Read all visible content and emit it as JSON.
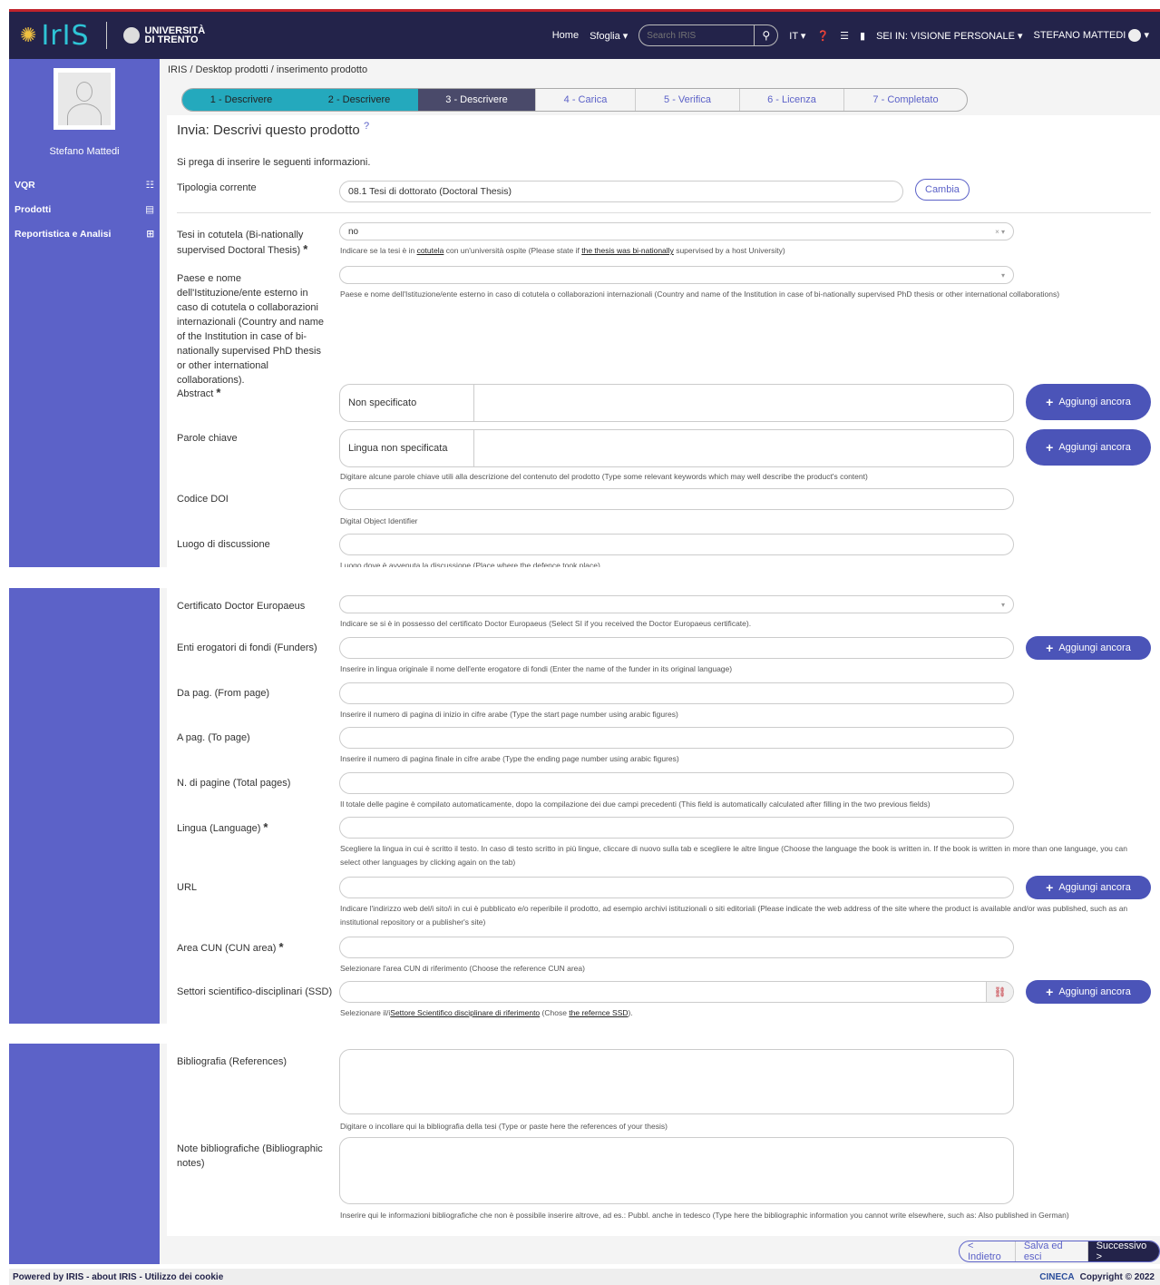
{
  "nav": {
    "home": "Home",
    "browse": "Sfoglia",
    "search_placeholder": "Search IRIS",
    "lang": "IT",
    "context": "SEI IN: VISIONE PERSONALE",
    "user": "STEFANO MATTEDI",
    "unitn_line1": "UNIVERSITÀ",
    "unitn_line2": "DI TRENTO"
  },
  "sidebar": {
    "name": "Stefano Mattedi",
    "items": [
      {
        "label": "VQR",
        "icon": "list-icon"
      },
      {
        "label": "Prodotti",
        "icon": "bookmark-icon"
      },
      {
        "label": "Reportistica e Analisi",
        "icon": "table-icon"
      }
    ]
  },
  "breadcrumb": "IRIS  /  Desktop prodotti  /  inserimento prodotto",
  "steps": [
    "1 - Descrivere",
    "2 - Descrivere",
    "3 - Descrivere",
    "4 - Carica",
    "5 - Verifica",
    "6 - Licenza",
    "7 - Completato"
  ],
  "title": "Invia: Descrivi questo prodotto",
  "intro": "Si prega di inserire le seguenti informazioni.",
  "tipologia": {
    "label": "Tipologia corrente",
    "value": "08.1 Tesi di dottorato (Doctoral Thesis)",
    "button": "Cambia"
  },
  "fields": {
    "cotutela": {
      "label": "Tesi in cotutela (Bi-nationally supervised Doctoral Thesis)",
      "value": "no",
      "help_a": "Indicare se la tesi è in ",
      "help_u1": "cotutela",
      "help_b": " con un'università ospite (Please state if ",
      "help_u2": "the thesis was bi-nationally",
      "help_c": " supervised by a host University)"
    },
    "paese": {
      "label": "Paese e nome dell'Istituzione/ente esterno in caso di cotutela o collaborazioni internazionali (Country and name of the Institution in case of bi-nationally supervised PhD thesis or other international collaborations).",
      "help": "Paese e nome dell'Istituzione/ente esterno in caso di cotutela o collaborazioni internazionali (Country and name of the Institution in case of bi-nationally supervised PhD thesis or other international collaborations)"
    },
    "abstract": {
      "label": "Abstract",
      "lang": "Non specificato"
    },
    "keywords": {
      "label": "Parole chiave",
      "lang": "Lingua non specificata",
      "help": "Digitare alcune parole chiave utili alla descrizione del contenuto del prodotto (Type some relevant keywords which may well describe the product's content)"
    },
    "doi": {
      "label": "Codice DOI",
      "help": "Digital Object Identifier"
    },
    "luogo": {
      "label": "Luogo di discussione",
      "help": "Luogo dove è avvenuta la discussione (Place where the defence took place)"
    },
    "europaeus": {
      "label": "Certificato Doctor Europaeus",
      "help": "Indicare se si è in possesso del certificato Doctor Europaeus (Select SI if you received the Doctor Europaeus certificate)."
    },
    "funders": {
      "label": "Enti erogatori di fondi (Funders)",
      "help": "Inserire in lingua originale il nome dell'ente erogatore di fondi (Enter the name of the funder in its original language)"
    },
    "from": {
      "label": "Da pag. (From page)",
      "help": "Inserire il numero di pagina di inizio in cifre arabe (Type the start page number using arabic figures)"
    },
    "to": {
      "label": "A pag. (To page)",
      "help": "Inserire il numero di pagina finale in cifre arabe (Type the ending page number using arabic figures)"
    },
    "total": {
      "label": "N. di pagine (Total pages)",
      "help": "Il totale delle pagine è compilato automaticamente, dopo la compilazione dei due campi precedenti (This field is automatically calculated after filling in the two previous fields)"
    },
    "lingua": {
      "label": "Lingua (Language)",
      "help": "Scegliere la lingua in cui è scritto il testo. In caso di testo scritto in più lingue, cliccare di nuovo sulla tab e scegliere le altre lingue (Choose the language the book is written in. If the book is written in more than one language, you can select other languages by clicking again on the tab)"
    },
    "url": {
      "label": "URL",
      "help": "Indicare l'indirizzo web del/i sito/i in cui è pubblicato e/o reperibile il prodotto, ad esempio archivi istituzionali o siti editoriali (Please indicate the web address of the site where the product is available and/or was published, such as an institutional repository or a publisher's site)"
    },
    "cun": {
      "label": "Area CUN (CUN area)",
      "help": "Selezionare l'area CUN di riferimento (Choose the reference CUN area)"
    },
    "ssd": {
      "label": "Settori scientifico-disciplinari (SSD)",
      "help_a": "Selezionare il/i",
      "help_u1": "Settore Scientifico disciplinare di riferimento",
      "help_b": " (Chose ",
      "help_u2": "the refernce SSD",
      "help_c": ")."
    },
    "biblio": {
      "label": "Bibliografia (References)",
      "help": "Digitare o incollare qui la bibliografia della tesi (Type or paste here the references of your thesis)"
    },
    "note": {
      "label": "Note bibliografiche (Bibliographic notes)",
      "help": "Inserire qui le informazioni bibliografiche che non è possibile inserire altrove, ad es.: Pubbl. anche in tedesco (Type here the bibliographic information you cannot write elsewhere, such as: Also published in German)"
    }
  },
  "add_more": "Aggiungi ancora",
  "footer": {
    "back": "< Indietro",
    "save": "Salva ed esci",
    "next": "Successivo >"
  },
  "bottom": {
    "powered": "Powered by IRIS",
    "about": "about IRIS",
    "cookies": "Utilizzo dei cookie",
    "cineca": "CINECA",
    "copyright": "Copyright © 2022"
  }
}
